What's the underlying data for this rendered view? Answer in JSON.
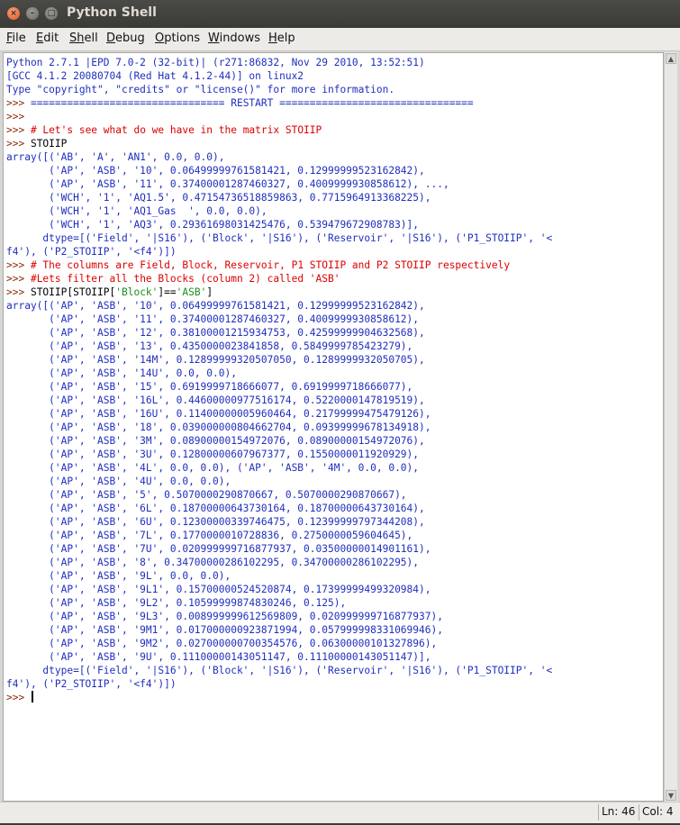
{
  "window": {
    "title": "Python Shell",
    "controls": {
      "close": "×",
      "minimize": "–",
      "maximize": "□"
    }
  },
  "menubar": [
    {
      "key": "file",
      "first": "F",
      "rest": "ile"
    },
    {
      "key": "edit",
      "first": "E",
      "rest": "dit"
    },
    {
      "key": "shell",
      "first": "Sh",
      "rest": "ell"
    },
    {
      "key": "debug",
      "first": "D",
      "rest": "ebug"
    },
    {
      "key": "options",
      "first": "O",
      "rest": "ptions"
    },
    {
      "key": "windows",
      "first": "W",
      "rest": "indows"
    },
    {
      "key": "help",
      "first": "H",
      "rest": "elp"
    }
  ],
  "shell": {
    "lines": [
      [
        [
          "out",
          "Python 2.7.1 |EPD 7.0-2 (32-bit)| (r271:86832, Nov 29 2010, 13:52:51)"
        ]
      ],
      [
        [
          "out",
          "[GCC 4.1.2 20080704 (Red Hat 4.1.2-44)] on linux2"
        ]
      ],
      [
        [
          "out",
          "Type \"copyright\", \"credits\" or \"license()\" for more information."
        ]
      ],
      [
        [
          "prompt",
          ">>> "
        ],
        [
          "out",
          "================================ RESTART ================================"
        ]
      ],
      [
        [
          "prompt",
          ">>> "
        ]
      ],
      [
        [
          "prompt",
          ">>> "
        ],
        [
          "comment",
          "# Let's see what do we have in the matrix STOIIP"
        ]
      ],
      [
        [
          "prompt",
          ">>> "
        ],
        [
          "plain",
          "STOIIP"
        ]
      ],
      [
        [
          "out",
          "array([('AB', 'A', 'AN1', 0.0, 0.0),"
        ]
      ],
      [
        [
          "out",
          "       ('AP', 'ASB', '10', 0.06499999761581421, 0.12999999523162842),"
        ]
      ],
      [
        [
          "out",
          "       ('AP', 'ASB', '11', 0.3740000128746032​7, 0.4009999930858612), ...,"
        ]
      ],
      [
        [
          "out",
          "       ('WCH', '1', 'AQ1.5', 0.47154736518859863, 0.7715964913368225),"
        ]
      ],
      [
        [
          "out",
          "       ('WCH', '1', 'AQ1_Gas  ', 0.0, 0.0),"
        ]
      ],
      [
        [
          "out",
          "       ('WCH', '1', 'AQ3', 0.29361698031425476, 0.539479672908783)],"
        ]
      ],
      [
        [
          "out",
          "      dtype=[('Field', '|S16'), ('Block', '|S16'), ('Reservoir', '|S16'), ('P1_STOIIP', '<"
        ]
      ],
      [
        [
          "out",
          "f4'), ('P2_STOIIP', '<f4')])"
        ]
      ],
      [
        [
          "prompt",
          ">>> "
        ],
        [
          "comment",
          "# The columns are Field, Block, Reservoir, P1 STOIIP and P2 STOIIP respectively"
        ]
      ],
      [
        [
          "prompt",
          ">>> "
        ],
        [
          "comment",
          "#Lets filter all the Blocks (column 2) called 'ASB'"
        ]
      ],
      [
        [
          "prompt",
          ">>> "
        ],
        [
          "plain",
          "STOIIP[STOIIP["
        ],
        [
          "str",
          "'Block'"
        ],
        [
          "plain",
          "]=="
        ],
        [
          "str",
          "'ASB'"
        ],
        [
          "plain",
          "]"
        ]
      ],
      [
        [
          "out",
          "array([('AP', 'ASB', '10', 0.06499999761581421, 0.12999999523162842),"
        ]
      ],
      [
        [
          "out",
          "       ('AP', 'ASB', '11', 0.37400001287460327, 0.4009999930858612),"
        ]
      ],
      [
        [
          "out",
          "       ('AP', 'ASB', '12', 0.38100001215934753, 0.42599999904632568),"
        ]
      ],
      [
        [
          "out",
          "       ('AP', 'ASB', '13', 0.4350000023841858, 0.5849999785423279),"
        ]
      ],
      [
        [
          "out",
          "       ('AP', 'ASB', '14M', 0.12899999320507050, 0.1289999932050705),"
        ]
      ],
      [
        [
          "out",
          "       ('AP', 'ASB', '14U', 0.0, 0.0),"
        ]
      ],
      [
        [
          "out",
          "       ('AP', 'ASB', '15', 0.691999971866607​7, 0.6919999718666077),"
        ]
      ],
      [
        [
          "out",
          "       ('AP', 'ASB', '16L', 0.44600000977516174, 0.5220000147819519),"
        ]
      ],
      [
        [
          "out",
          "       ('AP', 'ASB', '16U', 0.11400000005960464, 0.21799999475479126),"
        ]
      ],
      [
        [
          "out",
          "       ('AP', 'ASB', '18', 0.03900000080466270​4, 0.09399999678134918),"
        ]
      ],
      [
        [
          "out",
          "       ('AP', 'ASB', '3M', 0.08900000154972076, 0.08900000154972076),"
        ]
      ],
      [
        [
          "out",
          "       ('AP', 'ASB', '3U', 0.12800000607967377, 0.1550000011920929),"
        ]
      ],
      [
        [
          "out",
          "       ('AP', 'ASB', '4L', 0.0, 0.0), ('AP', 'ASB', '4M', 0.0, 0.0),"
        ]
      ],
      [
        [
          "out",
          "       ('AP', 'ASB', '4U', 0.0, 0.0),"
        ]
      ],
      [
        [
          "out",
          "       ('AP', 'ASB', '5', 0.5070000290870667, 0.5070000290870667),"
        ]
      ],
      [
        [
          "out",
          "       ('AP', 'ASB', '6L', 0.18700000643730164, 0.18700000643730164),"
        ]
      ],
      [
        [
          "out",
          "       ('AP', 'ASB', '6U', 0.12300000339746475, 0.12399999797344208),"
        ]
      ],
      [
        [
          "out",
          "       ('AP', 'ASB', '7L', 0.1770000010728836, 0.2750000059604645),"
        ]
      ],
      [
        [
          "out",
          "       ('AP', 'ASB', '7U', 0.020999999716877937, 0.03500000014901161),"
        ]
      ],
      [
        [
          "out",
          "       ('AP', 'ASB', '8', 0.34700000286102295, 0.34700000286102295),"
        ]
      ],
      [
        [
          "out",
          "       ('AP', 'ASB', '9L', 0.0, 0.0),"
        ]
      ],
      [
        [
          "out",
          "       ('AP', 'ASB', '9L1', 0.1570000052452087​4, 0.17399999499320984),"
        ]
      ],
      [
        [
          "out",
          "       ('AP', 'ASB', '9L2', 0.10599999874830246, 0.125),"
        ]
      ],
      [
        [
          "out",
          "       ('AP', 'ASB', '9L3', 0.008999999612569809, 0.020999999716877937),"
        ]
      ],
      [
        [
          "out",
          "       ('AP', 'ASB', '9M1', 0.017000000923871994, 0.05799999833106994​6),"
        ]
      ],
      [
        [
          "out",
          "       ('AP', 'ASB', '9M2', 0.027000000700354576, 0.06300000101327896),"
        ]
      ],
      [
        [
          "out",
          "       ('AP', 'ASB', '9U', 0.11100000143051147, 0.11100000143051147)],"
        ]
      ],
      [
        [
          "out",
          "      dtype=[('Field', '|S16'), ('Block', '|S16'), ('Reservoir', '|S16'), ('P1_STOIIP', '<"
        ]
      ],
      [
        [
          "out",
          "f4'), ('P2_STOIIP', '<f4')])"
        ]
      ],
      [
        [
          "prompt",
          ">>> "
        ],
        [
          "cursor",
          ""
        ]
      ]
    ]
  },
  "status": {
    "line": "Ln: 46",
    "col": "Col: 4"
  },
  "colors": {
    "prompt": "#8b2a08",
    "comment": "#dd0000",
    "output": "#1f2fbd",
    "string": "#1d8c1d"
  }
}
